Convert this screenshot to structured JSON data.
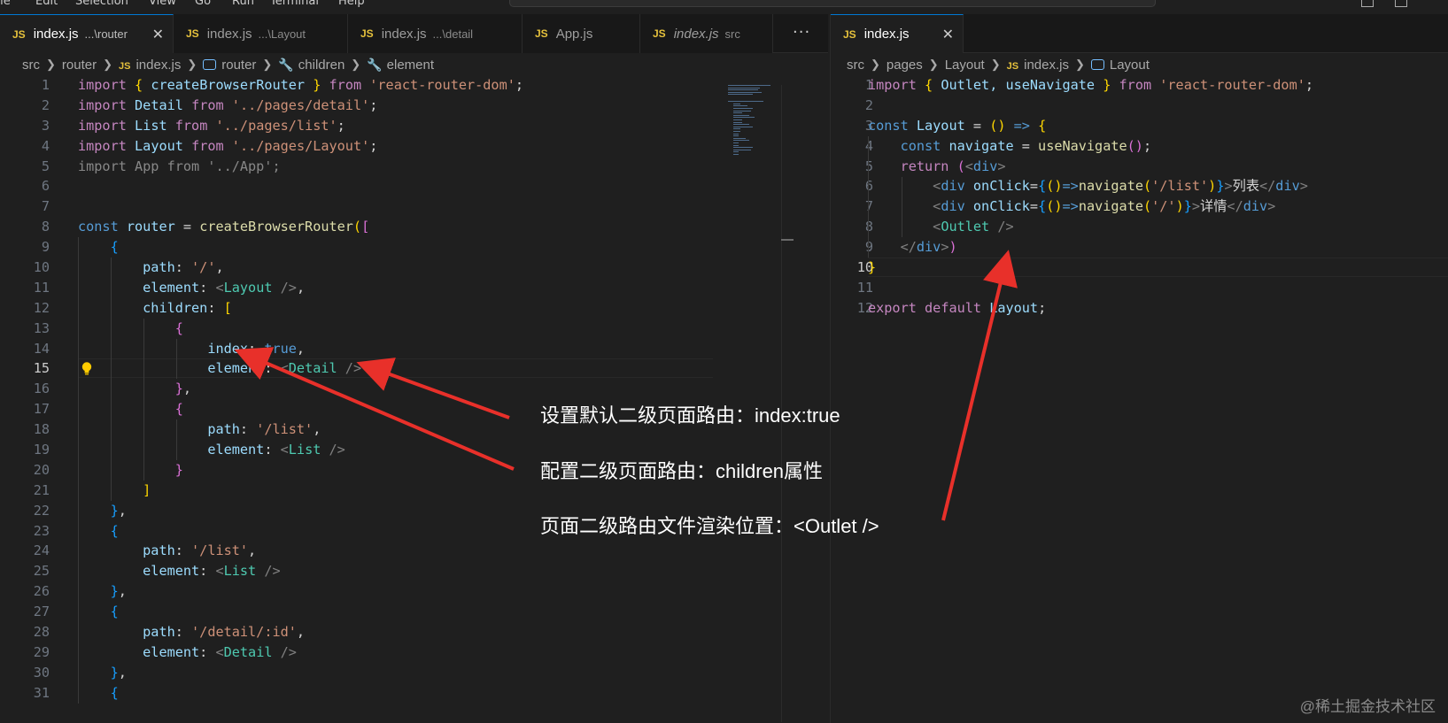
{
  "menu": [
    "File",
    "Edit",
    "Selection",
    "View",
    "Go",
    "Run",
    "Terminal",
    "Help"
  ],
  "left_editor": {
    "tabs": [
      {
        "name": "index.js",
        "desc": "...\\router",
        "active": true,
        "italic": false
      },
      {
        "name": "index.js",
        "desc": "...\\Layout",
        "active": false,
        "italic": false
      },
      {
        "name": "index.js",
        "desc": "...\\detail",
        "active": false,
        "italic": false
      },
      {
        "name": "App.js",
        "desc": "",
        "active": false,
        "italic": false
      },
      {
        "name": "index.js",
        "desc": "src",
        "active": false,
        "italic": true
      }
    ],
    "more_label": "···",
    "breadcrumb": [
      "src",
      "router",
      "index.js",
      "router",
      "children",
      "element"
    ],
    "current_line": 15,
    "lines": [
      [
        [
          "import",
          "kc"
        ],
        [
          " ",
          "w"
        ],
        [
          "{",
          "b1"
        ],
        [
          " createBrowserRouter ",
          "v"
        ],
        [
          "}",
          "b1"
        ],
        [
          " ",
          "w"
        ],
        [
          "from",
          "kc"
        ],
        [
          " ",
          "w"
        ],
        [
          "'react-router-dom'",
          "s"
        ],
        [
          ";",
          "p"
        ]
      ],
      [
        [
          "import",
          "kc"
        ],
        [
          " ",
          "w"
        ],
        [
          "Detail",
          "v"
        ],
        [
          " ",
          "w"
        ],
        [
          "from",
          "kc"
        ],
        [
          " ",
          "w"
        ],
        [
          "'../pages/detail'",
          "s"
        ],
        [
          ";",
          "p"
        ]
      ],
      [
        [
          "import",
          "kc"
        ],
        [
          " ",
          "w"
        ],
        [
          "List",
          "v"
        ],
        [
          " ",
          "w"
        ],
        [
          "from",
          "kc"
        ],
        [
          " ",
          "w"
        ],
        [
          "'../pages/list'",
          "s"
        ],
        [
          ";",
          "p"
        ]
      ],
      [
        [
          "import",
          "kc"
        ],
        [
          " ",
          "w"
        ],
        [
          "Layout",
          "v"
        ],
        [
          " ",
          "w"
        ],
        [
          "from",
          "kc"
        ],
        [
          " ",
          "w"
        ],
        [
          "'../pages/Layout'",
          "s"
        ],
        [
          ";",
          "p"
        ]
      ],
      [
        [
          "import App from '../App';",
          "dim"
        ]
      ],
      [],
      [],
      [
        [
          "const",
          "k"
        ],
        [
          " ",
          "w"
        ],
        [
          "router",
          "v"
        ],
        [
          " = ",
          "p"
        ],
        [
          "createBrowserRouter",
          "f"
        ],
        [
          "(",
          "b1"
        ],
        [
          "[",
          "b2"
        ]
      ],
      [
        [
          "    ",
          "w"
        ],
        [
          "{",
          "b3"
        ]
      ],
      [
        [
          "        ",
          "w"
        ],
        [
          "path",
          "v"
        ],
        [
          ": ",
          "p"
        ],
        [
          "'/'",
          "s"
        ],
        [
          ",",
          "p"
        ]
      ],
      [
        [
          "        ",
          "w"
        ],
        [
          "element",
          "v"
        ],
        [
          ": ",
          "p"
        ],
        [
          "<",
          "g"
        ],
        [
          "Layout",
          "t"
        ],
        [
          " />",
          "g"
        ],
        [
          ",",
          "p"
        ]
      ],
      [
        [
          "        ",
          "w"
        ],
        [
          "children",
          "v"
        ],
        [
          ": ",
          "p"
        ],
        [
          "[",
          "b1"
        ]
      ],
      [
        [
          "            ",
          "w"
        ],
        [
          "{",
          "b2"
        ]
      ],
      [
        [
          "                ",
          "w"
        ],
        [
          "index",
          "v"
        ],
        [
          ": ",
          "p"
        ],
        [
          "true",
          "k"
        ],
        [
          ",",
          "p"
        ]
      ],
      [
        [
          "                ",
          "w"
        ],
        [
          "element",
          "v"
        ],
        [
          ": ",
          "p"
        ],
        [
          "<",
          "g"
        ],
        [
          "Detail",
          "t"
        ],
        [
          " />",
          "g"
        ]
      ],
      [
        [
          "            ",
          "w"
        ],
        [
          "}",
          "b2"
        ],
        [
          ",",
          "p"
        ]
      ],
      [
        [
          "            ",
          "w"
        ],
        [
          "{",
          "b2"
        ]
      ],
      [
        [
          "                ",
          "w"
        ],
        [
          "path",
          "v"
        ],
        [
          ": ",
          "p"
        ],
        [
          "'/list'",
          "s"
        ],
        [
          ",",
          "p"
        ]
      ],
      [
        [
          "                ",
          "w"
        ],
        [
          "element",
          "v"
        ],
        [
          ": ",
          "p"
        ],
        [
          "<",
          "g"
        ],
        [
          "List",
          "t"
        ],
        [
          " />",
          "g"
        ]
      ],
      [
        [
          "            ",
          "w"
        ],
        [
          "}",
          "b2"
        ]
      ],
      [
        [
          "        ",
          "w"
        ],
        [
          "]",
          "b1"
        ]
      ],
      [
        [
          "    ",
          "w"
        ],
        [
          "}",
          "b3"
        ],
        [
          ",",
          "p"
        ]
      ],
      [
        [
          "    ",
          "w"
        ],
        [
          "{",
          "b3"
        ]
      ],
      [
        [
          "        ",
          "w"
        ],
        [
          "path",
          "v"
        ],
        [
          ": ",
          "p"
        ],
        [
          "'/list'",
          "s"
        ],
        [
          ",",
          "p"
        ]
      ],
      [
        [
          "        ",
          "w"
        ],
        [
          "element",
          "v"
        ],
        [
          ": ",
          "p"
        ],
        [
          "<",
          "g"
        ],
        [
          "List",
          "t"
        ],
        [
          " />",
          "g"
        ]
      ],
      [
        [
          "    ",
          "w"
        ],
        [
          "}",
          "b3"
        ],
        [
          ",",
          "p"
        ]
      ],
      [
        [
          "    ",
          "w"
        ],
        [
          "{",
          "b3"
        ]
      ],
      [
        [
          "        ",
          "w"
        ],
        [
          "path",
          "v"
        ],
        [
          ": ",
          "p"
        ],
        [
          "'/detail/:id'",
          "s"
        ],
        [
          ",",
          "p"
        ]
      ],
      [
        [
          "        ",
          "w"
        ],
        [
          "element",
          "v"
        ],
        [
          ": ",
          "p"
        ],
        [
          "<",
          "g"
        ],
        [
          "Detail",
          "t"
        ],
        [
          " />",
          "g"
        ]
      ],
      [
        [
          "    ",
          "w"
        ],
        [
          "}",
          "b3"
        ],
        [
          ",",
          "p"
        ]
      ],
      [
        [
          "    ",
          "w"
        ],
        [
          "{",
          "b3"
        ]
      ]
    ]
  },
  "right_editor": {
    "tabs": [
      {
        "name": "index.js",
        "desc": "",
        "active": true,
        "italic": false
      }
    ],
    "breadcrumb": [
      "src",
      "pages",
      "Layout",
      "index.js",
      "Layout"
    ],
    "current_line": 10,
    "lines": [
      [
        [
          "import",
          "kc"
        ],
        [
          " ",
          "w"
        ],
        [
          "{",
          "b1"
        ],
        [
          " Outlet, useNavigate ",
          "v"
        ],
        [
          "}",
          "b1"
        ],
        [
          " ",
          "w"
        ],
        [
          "from",
          "kc"
        ],
        [
          " ",
          "w"
        ],
        [
          "'react-router-dom'",
          "s"
        ],
        [
          ";",
          "p"
        ]
      ],
      [],
      [
        [
          "const",
          "k"
        ],
        [
          " ",
          "w"
        ],
        [
          "Layout",
          "v"
        ],
        [
          " = ",
          "p"
        ],
        [
          "()",
          "b1"
        ],
        [
          " ",
          "w"
        ],
        [
          "=>",
          "k"
        ],
        [
          " ",
          "w"
        ],
        [
          "{",
          "b1"
        ]
      ],
      [
        [
          "    ",
          "w"
        ],
        [
          "const",
          "k"
        ],
        [
          " ",
          "w"
        ],
        [
          "navigate",
          "v"
        ],
        [
          " = ",
          "p"
        ],
        [
          "useNavigate",
          "f"
        ],
        [
          "()",
          "b2"
        ],
        [
          ";",
          "p"
        ]
      ],
      [
        [
          "    ",
          "w"
        ],
        [
          "return",
          "kc"
        ],
        [
          " ",
          "w"
        ],
        [
          "(",
          "b2"
        ],
        [
          "<",
          "g"
        ],
        [
          "div",
          "k"
        ],
        [
          ">",
          "g"
        ]
      ],
      [
        [
          "        ",
          "w"
        ],
        [
          "<",
          "g"
        ],
        [
          "div",
          "k"
        ],
        [
          " ",
          "w"
        ],
        [
          "onClick",
          "v"
        ],
        [
          "=",
          "p"
        ],
        [
          "{",
          "b3"
        ],
        [
          "()",
          "b1"
        ],
        [
          "=>",
          "k"
        ],
        [
          "navigate",
          "f"
        ],
        [
          "(",
          "b1"
        ],
        [
          "'/list'",
          "s"
        ],
        [
          ")",
          "b1"
        ],
        [
          "}",
          "b3"
        ],
        [
          ">",
          "g"
        ],
        [
          "列表",
          "w"
        ],
        [
          "</",
          "g"
        ],
        [
          "div",
          "k"
        ],
        [
          ">",
          "g"
        ]
      ],
      [
        [
          "        ",
          "w"
        ],
        [
          "<",
          "g"
        ],
        [
          "div",
          "k"
        ],
        [
          " ",
          "w"
        ],
        [
          "onClick",
          "v"
        ],
        [
          "=",
          "p"
        ],
        [
          "{",
          "b3"
        ],
        [
          "()",
          "b1"
        ],
        [
          "=>",
          "k"
        ],
        [
          "navigate",
          "f"
        ],
        [
          "(",
          "b1"
        ],
        [
          "'/'",
          "s"
        ],
        [
          ")",
          "b1"
        ],
        [
          "}",
          "b3"
        ],
        [
          ">",
          "g"
        ],
        [
          "详情",
          "w"
        ],
        [
          "</",
          "g"
        ],
        [
          "div",
          "k"
        ],
        [
          ">",
          "g"
        ]
      ],
      [
        [
          "        ",
          "w"
        ],
        [
          "<",
          "g"
        ],
        [
          "Outlet",
          "t"
        ],
        [
          " />",
          "g"
        ]
      ],
      [
        [
          "    ",
          "w"
        ],
        [
          "</",
          "g"
        ],
        [
          "div",
          "k"
        ],
        [
          ">",
          "g"
        ],
        [
          ")",
          "b2"
        ]
      ],
      [
        [
          "}",
          "b1"
        ]
      ],
      [],
      [
        [
          "export",
          "kc"
        ],
        [
          " ",
          "w"
        ],
        [
          "default",
          "kc"
        ],
        [
          " ",
          "w"
        ],
        [
          "Layout",
          "v"
        ],
        [
          ";",
          "p"
        ]
      ]
    ]
  },
  "annotations": [
    "设置默认二级页面路由：index:true",
    "配置二级页面路由：children属性",
    "页面二级路由文件渲染位置：<Outlet />"
  ],
  "watermark": "@稀土掘金技术社区",
  "colors": {
    "arrow": "#e8302a",
    "accent": "#0078d4",
    "js_icon": "#e5c13c"
  }
}
